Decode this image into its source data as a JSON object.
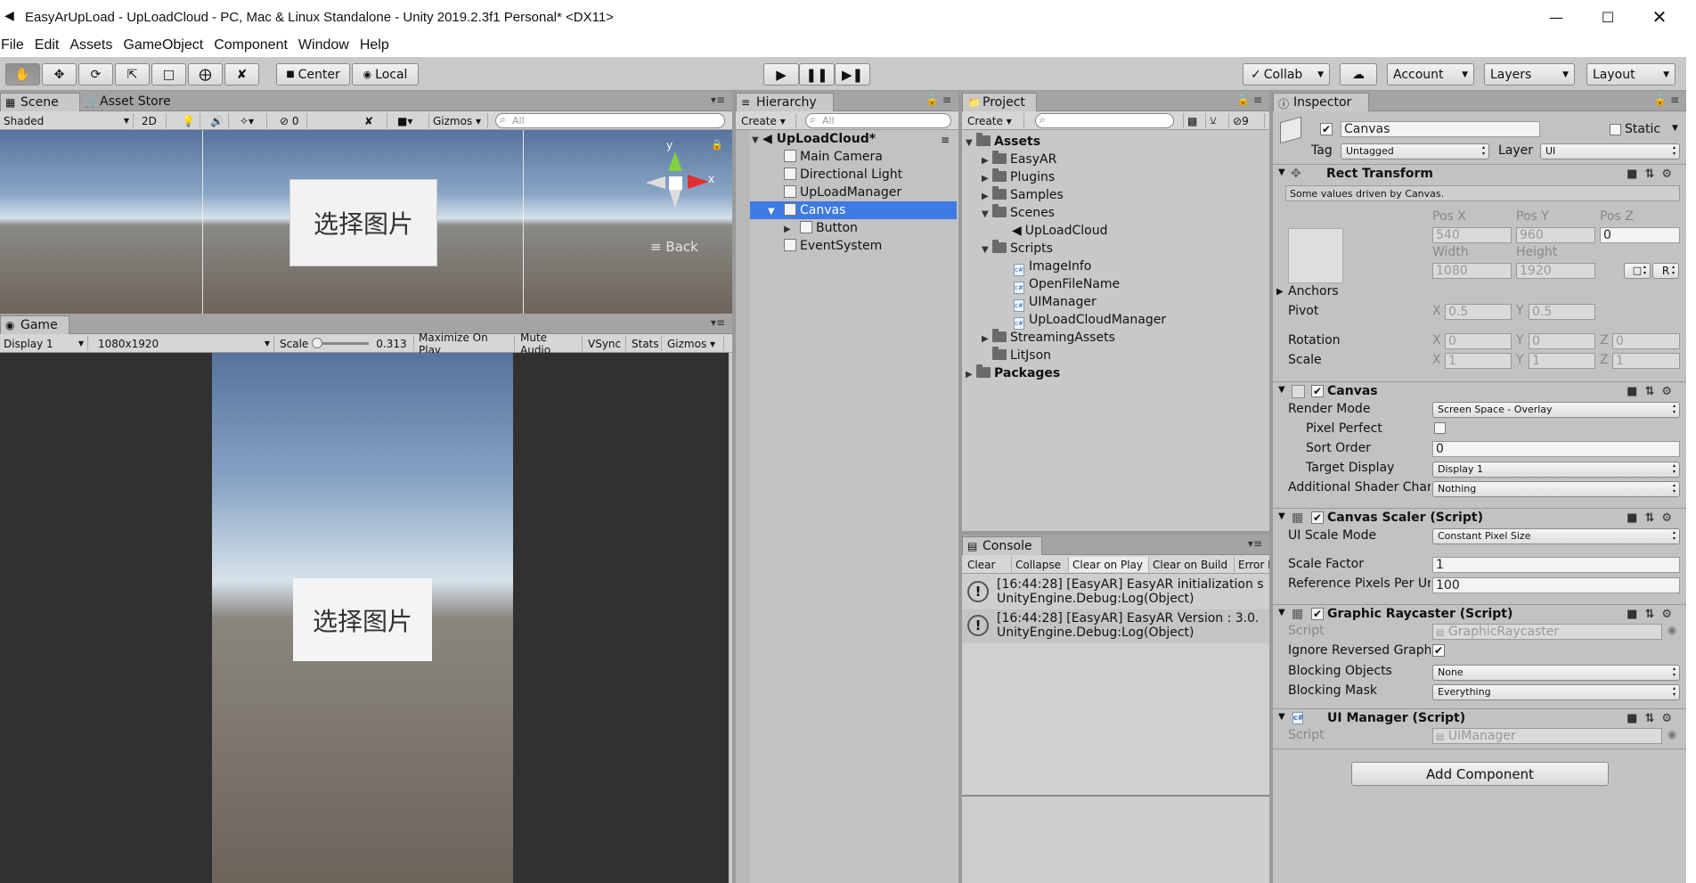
{
  "window": {
    "title": "EasyArUpLoad - UpLoadCloud - PC, Mac & Linux Standalone - Unity 2019.2.3f1 Personal* <DX11>"
  },
  "menu": [
    "File",
    "Edit",
    "Assets",
    "GameObject",
    "Component",
    "Window",
    "Help"
  ],
  "toolbar": {
    "center": "Center",
    "local": "Local",
    "collab": "Collab",
    "account": "Account",
    "layers": "Layers",
    "layout": "Layout"
  },
  "scene": {
    "tab": "Scene",
    "tab2": "Asset Store",
    "shading": "Shaded",
    "mode2d": "2D",
    "fx_count": "0",
    "gizmos": "Gizmos",
    "search_placeholder": "All",
    "button_text": "选择图片",
    "back_label": "Back",
    "axis_x": "x",
    "axis_y": "y"
  },
  "game": {
    "tab": "Game",
    "display": "Display 1",
    "resolution": "1080x1920",
    "scale_label": "Scale",
    "scale_value": "0.313",
    "maximize": "Maximize On Play",
    "mute": "Mute Audio",
    "vsync": "VSync",
    "stats": "Stats",
    "gizmos": "Gizmos",
    "button_text": "选择图片"
  },
  "hierarchy": {
    "tab": "Hierarchy",
    "create": "Create",
    "search_placeholder": "All",
    "scene": "UpLoadCloud*",
    "items": [
      "Main Camera",
      "Directional Light",
      "UpLoadManager",
      "Canvas",
      "Button",
      "EventSystem"
    ]
  },
  "project": {
    "tab": "Project",
    "create": "Create",
    "badge": "9",
    "assets": "Assets",
    "folders": [
      "EasyAR",
      "Plugins",
      "Samples",
      "Scenes"
    ],
    "scene_file": "UpLoadCloud",
    "scripts": "Scripts",
    "script_files": [
      "ImageInfo",
      "OpenFileName",
      "UIManager",
      "UpLoadCloudManager"
    ],
    "streaming": "StreamingAssets",
    "litjson": "LitJson",
    "packages": "Packages"
  },
  "console": {
    "tab": "Console",
    "buttons": [
      "Clear",
      "Collapse",
      "Clear on Play",
      "Clear on Build",
      "Error Pause"
    ],
    "logs": [
      {
        "line1": "[16:44:28] [EasyAR] EasyAR initialization s",
        "line2": "UnityEngine.Debug:Log(Object)"
      },
      {
        "line1": "[16:44:28] [EasyAR] EasyAR Version : 3.0.",
        "line2": "UnityEngine.Debug:Log(Object)"
      }
    ]
  },
  "inspector": {
    "tab": "Inspector",
    "name": "Canvas",
    "static": "Static",
    "tag_label": "Tag",
    "tag": "Untagged",
    "layer_label": "Layer",
    "layer": "UI",
    "rect": {
      "title": "Rect Transform",
      "note": "Some values driven by Canvas.",
      "posx": "Pos X",
      "posy": "Pos Y",
      "posz": "Pos Z",
      "vx": "540",
      "vy": "960",
      "vz": "0",
      "width_l": "Width",
      "height_l": "Height",
      "w": "1080",
      "h": "1920",
      "r": "R",
      "anchors": "Anchors",
      "pivot": "Pivot",
      "pvx": "0.5",
      "pvy": "0.5",
      "rotation": "Rotation",
      "rx": "0",
      "ry": "0",
      "rz": "0",
      "scale": "Scale",
      "sx": "1",
      "sy": "1",
      "sz": "1",
      "x": "X",
      "y": "Y",
      "z": "Z"
    },
    "canvas": {
      "title": "Canvas",
      "render_mode_l": "Render Mode",
      "render_mode": "Screen Space - Overlay",
      "pixel_perfect": "Pixel Perfect",
      "sort_order_l": "Sort Order",
      "sort_order": "0",
      "target_display_l": "Target Display",
      "target_display": "Display 1",
      "shader_l": "Additional Shader Char",
      "shader": "Nothing"
    },
    "scaler": {
      "title": "Canvas Scaler (Script)",
      "mode_l": "UI Scale Mode",
      "mode": "Constant Pixel Size",
      "factor_l": "Scale Factor",
      "factor": "1",
      "ref_l": "Reference Pixels Per Ur",
      "ref": "100"
    },
    "raycaster": {
      "title": "Graphic Raycaster (Script)",
      "script_l": "Script",
      "script": "GraphicRaycaster",
      "ignore_l": "Ignore Reversed Graph",
      "blocking_l": "Blocking Objects",
      "blocking": "None",
      "mask_l": "Blocking Mask",
      "mask": "Everything"
    },
    "uimanager": {
      "title": "UI Manager (Script)",
      "script_l": "Script",
      "script": "UIManager"
    },
    "add_component": "Add Component"
  }
}
